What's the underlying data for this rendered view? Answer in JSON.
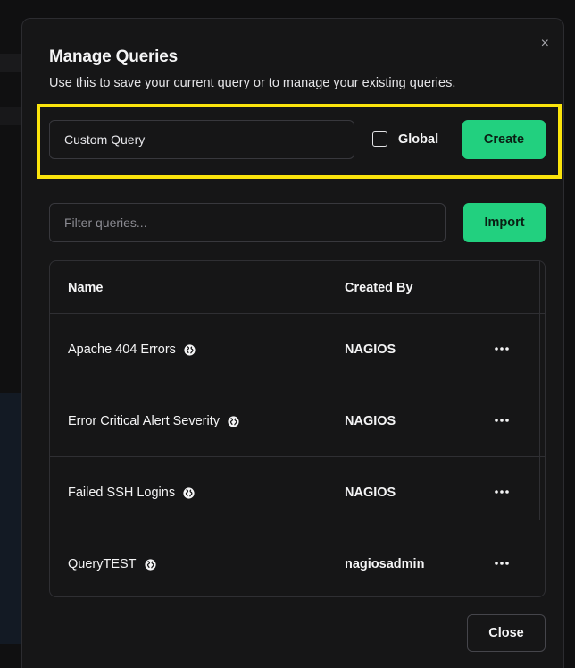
{
  "dialog": {
    "title": "Manage Queries",
    "subtitle": "Use this to save your current query or to manage your existing queries.",
    "close_icon": "×"
  },
  "create_form": {
    "query_name_value": "Custom Query",
    "global_label": "Global",
    "global_checked": false,
    "create_label": "Create",
    "highlight_color": "#fbe40c"
  },
  "filter": {
    "placeholder": "Filter queries...",
    "import_label": "Import"
  },
  "table": {
    "columns": {
      "name": "Name",
      "created_by": "Created By"
    },
    "rows": [
      {
        "name": "Apache 404 Errors",
        "created_by": "NAGIOS",
        "global": true
      },
      {
        "name": "Error Critical Alert Severity",
        "created_by": "NAGIOS",
        "global": true
      },
      {
        "name": "Failed SSH Logins",
        "created_by": "NAGIOS",
        "global": true
      },
      {
        "name": "QueryTEST",
        "created_by": "nagiosadmin",
        "global": true
      }
    ]
  },
  "footer": {
    "close_label": "Close"
  },
  "colors": {
    "accent_green": "#22d07f",
    "background": "#161617",
    "border": "#2f2f33",
    "text": "#f4f4f5"
  },
  "icons": {
    "globe": "globe-icon",
    "more": "more-horizontal-icon",
    "close": "close-icon",
    "checkbox": "checkbox-icon"
  }
}
